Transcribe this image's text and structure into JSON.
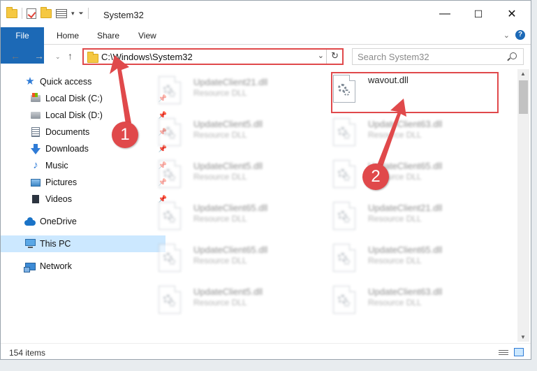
{
  "window": {
    "title": "System32",
    "controls": {
      "minimize": "—",
      "maximize": "☐",
      "close": "✕"
    }
  },
  "ribbon": {
    "tabs": [
      "File",
      "Home",
      "Share",
      "View"
    ]
  },
  "address_bar": {
    "path": "C:\\Windows\\System32"
  },
  "search": {
    "placeholder": "Search System32"
  },
  "sidebar": {
    "items": [
      {
        "label": "Quick access",
        "icon": "star-icon",
        "pinned": false
      },
      {
        "label": "Local Disk (C:)",
        "icon": "system-drive-icon",
        "pinned": true
      },
      {
        "label": "Local Disk (D:)",
        "icon": "drive-icon",
        "pinned": true
      },
      {
        "label": "Documents",
        "icon": "documents-icon",
        "pinned": true
      },
      {
        "label": "Downloads",
        "icon": "downloads-icon",
        "pinned": true
      },
      {
        "label": "Music",
        "icon": "music-icon",
        "pinned": true
      },
      {
        "label": "Pictures",
        "icon": "pictures-icon",
        "pinned": true
      },
      {
        "label": "Videos",
        "icon": "videos-icon",
        "pinned": true
      },
      {
        "label": "OneDrive",
        "icon": "onedrive-icon",
        "pinned": false
      },
      {
        "label": "This PC",
        "icon": "this-pc-icon",
        "pinned": false,
        "selected": true
      },
      {
        "label": "Network",
        "icon": "network-icon",
        "pinned": false
      }
    ]
  },
  "files": {
    "left_column": [
      {
        "name": "UpdateClient21.dll",
        "type": "Resource DLL"
      },
      {
        "name": "UpdateClient5.dll",
        "type": "Resource DLL"
      },
      {
        "name": "UpdateClient5.dll",
        "type": "Resource DLL"
      },
      {
        "name": "UpdateClient65.dll",
        "type": "Resource DLL"
      },
      {
        "name": "UpdateClient65.dll",
        "type": "Resource DLL"
      },
      {
        "name": "UpdateClient5.dll",
        "type": "Resource DLL"
      }
    ],
    "right_column": [
      {
        "name": "wavout.dll",
        "type": "",
        "highlighted": true
      },
      {
        "name": "UpdateClient63.dll",
        "type": "Resource DLL"
      },
      {
        "name": "UpdateClient65.dll",
        "type": "Resource DLL"
      },
      {
        "name": "UpdateClient21.dll",
        "type": "Resource DLL"
      },
      {
        "name": "UpdateClient65.dll",
        "type": "Resource DLL"
      },
      {
        "name": "UpdateClient63.dll",
        "type": "Resource DLL"
      }
    ]
  },
  "status": {
    "item_count": "154 items"
  },
  "annotations": {
    "step1": "1",
    "step2": "2",
    "color": "#e0494b"
  }
}
